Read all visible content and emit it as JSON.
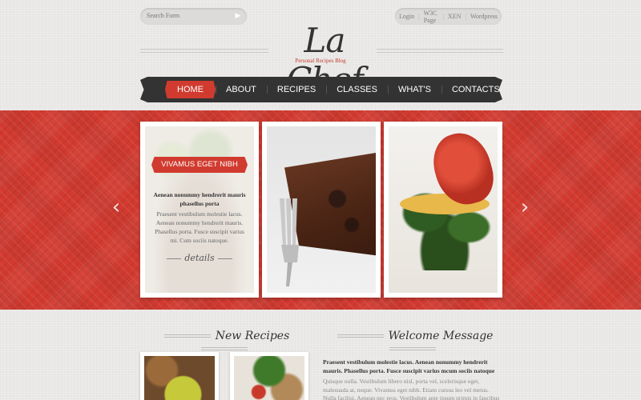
{
  "search": {
    "placeholder": "Search Form"
  },
  "top_links": [
    "Login",
    "W3C Page",
    "XEN",
    "Wordpress"
  ],
  "logo": {
    "title": "La Chef",
    "tagline": "Personal Recipes Blog"
  },
  "nav": {
    "items": [
      {
        "label": "HOME",
        "active": true
      },
      {
        "label": "ABOUT",
        "active": false
      },
      {
        "label": "RECIPES",
        "active": false
      },
      {
        "label": "CLASSES",
        "active": false
      },
      {
        "label": "WHAT'S NEW?",
        "active": false
      },
      {
        "label": "CONTACTS",
        "active": false
      }
    ]
  },
  "slider": {
    "cards": [
      {
        "ribbon": "VIVAMUS EGET NIBH",
        "heading": "Aenean nonummy hendrerit mauris phasellus porta",
        "body": "Praesent vestibulum molestie lacus. Aenean nonummy hendrerit mauris. Phasellus porta. Fusce suscipit varius mi. Cum sociis natoque.",
        "link": "details"
      }
    ]
  },
  "sections": {
    "new_recipes": "New Recipes",
    "welcome": "Welcome Message"
  },
  "welcome": {
    "bold": "Praesent vestibulum molestie lacus. Aenean nonummy hendrerit mauris. Phasellus porta. Fusce suscipit varius mcum sociis natoque",
    "body": "Quisque nulla. Vestibulum libero nisl, porta vel, scelerisque eget, malesuada at, neque. Vivamus eget nibh. Etiam cursus leo vel metus. Nulla facilisi. Aenean nec eros. Vestibulum ante ipsum primis in faucibus orci"
  },
  "colors": {
    "accent": "#d13b2f",
    "nav_bg": "#333333"
  }
}
